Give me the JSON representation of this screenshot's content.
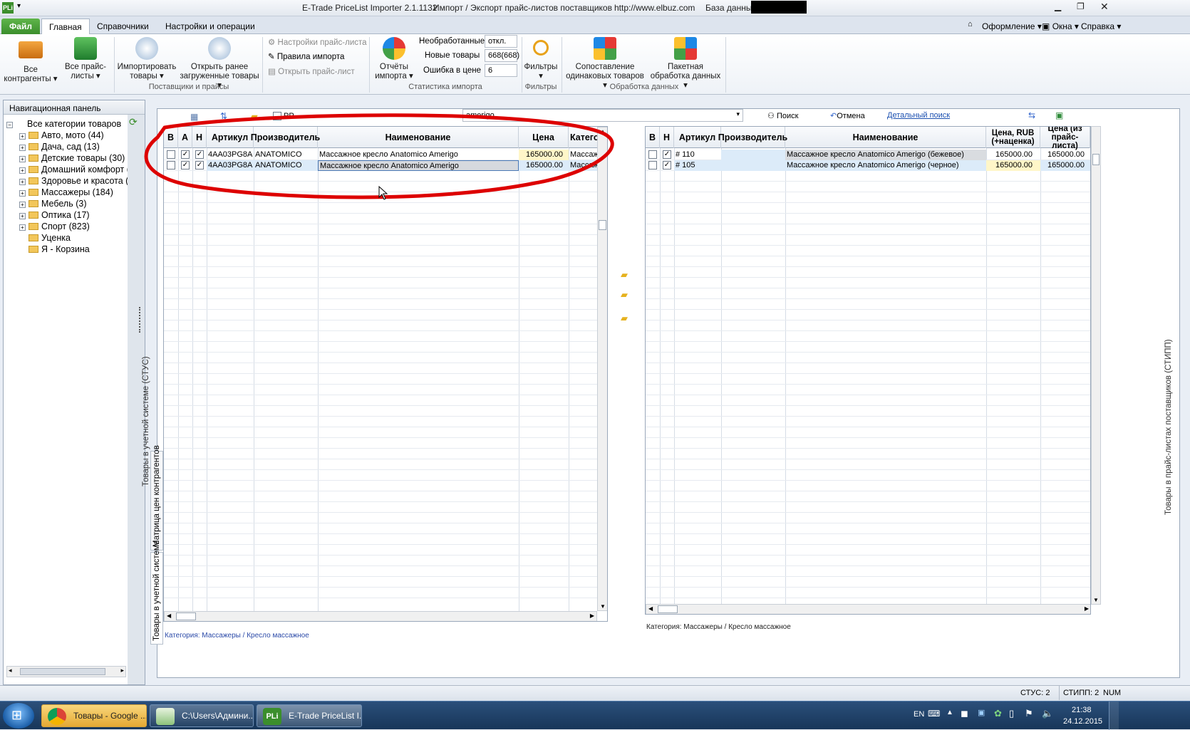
{
  "titlebar": {
    "app_title": "E-Trade PriceList Importer 2.1.1132",
    "subtitle": "Импорт / Экспорт прайс-листов поставщиков",
    "url": "http://www.elbuz.com",
    "db_label": "База данных"
  },
  "menu": {
    "file": "Файл",
    "tabs": [
      "Главная",
      "Справочники",
      "Настройки и операции"
    ],
    "right": [
      "Оформление",
      "Окна",
      "Справка"
    ]
  },
  "ribbon": {
    "all_contractors": "Все контрагенты",
    "all_pricelists": "Все прайс-листы",
    "import_goods": "Импортировать товары",
    "open_loaded": "Открыть ранее загруженные товары",
    "pricelist_settings": "Настройки прайс-листа",
    "import_rules": "Правила импорта",
    "open_pricelist": "Открыть прайс-лист",
    "group_suppliers": "Поставщики и прайсы",
    "reports": "Отчёты импорта",
    "unprocessed_label": "Необработанные",
    "unprocessed_value": "откл.",
    "new_goods_label": "Новые товары",
    "new_goods_value": "668(668)",
    "price_error_label": "Ошибка в цене",
    "price_error_value": "6",
    "group_stats": "Статистика импорта",
    "filters": "Фильтры",
    "group_filters": "Фильтры",
    "match_goods": "Сопоставление одинаковых товаров",
    "batch_processing": "Пакетная обработка данных",
    "group_processing": "Обработка данных"
  },
  "nav": {
    "header": "Навигационная панель",
    "items": [
      {
        "label": "Все категории товаров",
        "level": 0
      },
      {
        "label": "Авто, мото (44)",
        "level": 1
      },
      {
        "label": "Дача, сад (13)",
        "level": 1
      },
      {
        "label": "Детские товары (30)",
        "level": 1
      },
      {
        "label": "Домашний комфорт (",
        "level": 1
      },
      {
        "label": "Здоровье и красота (5",
        "level": 1
      },
      {
        "label": "Массажеры (184)",
        "level": 1
      },
      {
        "label": "Мебель (3)",
        "level": 1
      },
      {
        "label": "Оптика (17)",
        "level": 1
      },
      {
        "label": "Спорт (823)",
        "level": 1
      },
      {
        "label": "Уценка",
        "level": 2
      },
      {
        "label": "Я - Корзина",
        "level": 2
      }
    ]
  },
  "toolbar": {
    "pp_label": "PP",
    "search_value": "amerigo",
    "search_btn": "Поиск",
    "cancel_btn": "Отмена",
    "detail_search": "Детальный поиск"
  },
  "left_grid": {
    "columns": [
      "В",
      "А",
      "Н",
      "Артикул",
      "Производитель",
      "Наименование",
      "Цена",
      "Катего"
    ],
    "rows": [
      {
        "article": "4AA03PG8A",
        "maker": "ANATOMICO",
        "name": "Массажное кресло Anatomico Amerigo",
        "price": "165000.00",
        "cat": "Массаж"
      },
      {
        "article": "4AA03PG8A",
        "maker": "ANATOMICO",
        "name": "Массажное кресло Anatomico Amerigo",
        "price": "165000.00",
        "cat": "Массаж"
      }
    ],
    "footer": "Категория: Массажеры / Кресло массажное"
  },
  "right_grid": {
    "columns": [
      "В",
      "Н",
      "Артикул",
      "Производитель",
      "Наименование",
      "Цена, RUB (+наценка)",
      "Цена (из прайс-листа)"
    ],
    "rows": [
      {
        "article": "# 110",
        "maker": "",
        "name": "Массажное кресло Anatomico Amerigo (бежевое)",
        "price": "165000.00",
        "price2": "165000.00"
      },
      {
        "article": "# 105",
        "maker": "",
        "name": "Массажное кресло Anatomico Amerigo (черное)",
        "price": "165000.00",
        "price2": "165000.00"
      }
    ],
    "footer": "Категория: Массажеры / Кресло массажное"
  },
  "side_tabs": {
    "left_top": "Товары в учетной системе (СТУС)",
    "matrix": "Матрица цен контрагентов",
    "left_bottom": "Товары в учетной системе",
    "right": "Товары в прайс-листах поставщиков (СТИПП)"
  },
  "status": {
    "stus": "СТУС: 2",
    "stipp": "СТИПП: 2",
    "num": "NUM"
  },
  "taskbar": {
    "items": [
      "Товары - Google ...",
      "C:\\Users\\Админи...",
      "E-Trade PriceList I..."
    ],
    "lang": "EN",
    "time": "21:38",
    "date": "24.12.2015"
  },
  "colors": {
    "accent_green": "#3b8e2c",
    "highlight_yellow": "#fff6c8",
    "selection": "#dcebf9",
    "annotation_red": "#dd0000"
  }
}
